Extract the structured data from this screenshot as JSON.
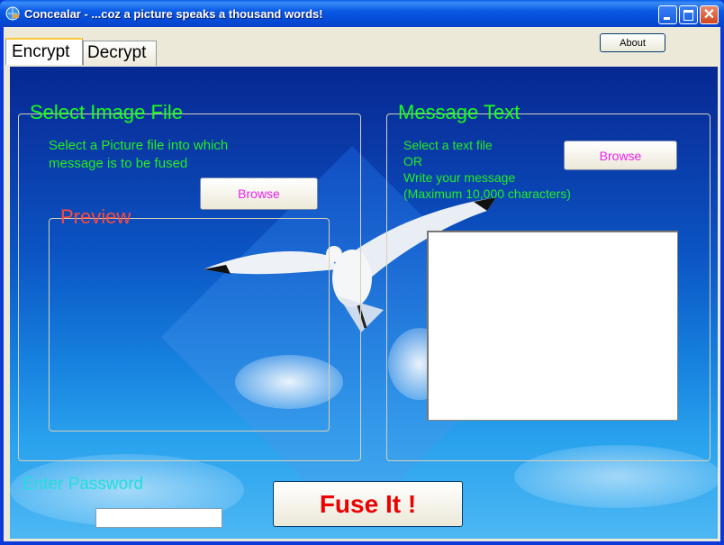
{
  "window": {
    "title": "Concealar - ...coz a picture speaks a thousand words!",
    "app_icon": "globe-key-icon",
    "controls": {
      "minimize": "minimize-icon",
      "maximize": "maximize-icon",
      "close": "✕"
    }
  },
  "toolbar": {
    "about_label": "About"
  },
  "tabs": [
    {
      "label": "Encrypt",
      "active": true
    },
    {
      "label": "Decrypt",
      "active": false
    }
  ],
  "image_group": {
    "title": "Select Image File",
    "instruction_line1": "Select a Picture file into which",
    "instruction_line2": "message is to be fused",
    "browse_label": "Browse",
    "preview_title": "Preview"
  },
  "message_group": {
    "title": "Message Text",
    "line1": "Select a text file",
    "line2": "OR",
    "line3": "Write your message",
    "line4": "(Maximum 10,000 characters)",
    "browse_label": "Browse",
    "message_value": ""
  },
  "password": {
    "label": "Enter Password",
    "value": ""
  },
  "fuse_label": "Fuse It !",
  "colors": {
    "group_title": "#1aff1a",
    "preview_title": "#ff4a3a",
    "browse_text": "#ee22ee",
    "password_label": "#22dddd",
    "fuse_text": "#ee0000"
  }
}
